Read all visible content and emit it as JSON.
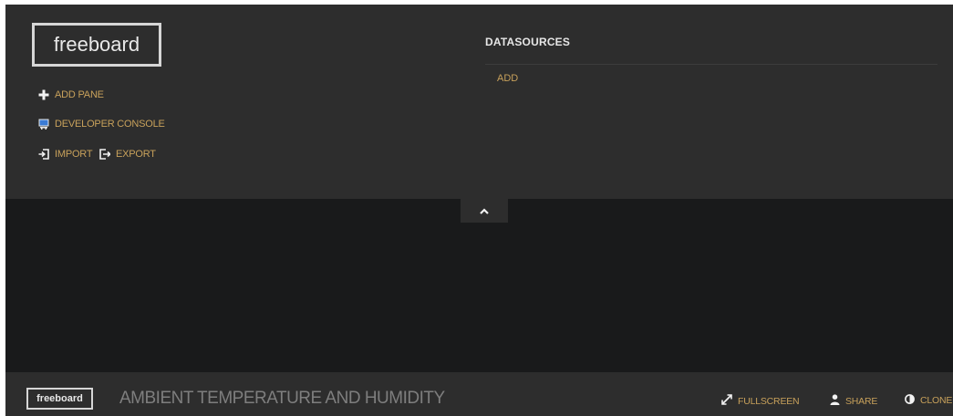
{
  "colors": {
    "panel_bg": "#2d2d2d",
    "board_bg": "#191a1b",
    "accent": "#c8a15b",
    "text_light": "#e6e6e6",
    "title_muted": "#7e7e7e"
  },
  "admin": {
    "logo": "freeboard",
    "menu": {
      "add_pane": {
        "label": "ADD PANE",
        "icon": "plus-icon"
      },
      "developer_console": {
        "label": "DEVELOPER CONSOLE",
        "icon": "console-icon"
      },
      "import": {
        "label": "IMPORT",
        "icon": "import-icon"
      },
      "export": {
        "label": "EXPORT",
        "icon": "export-icon"
      }
    },
    "datasources": {
      "heading": "DATASOURCES",
      "add_label": "ADD"
    },
    "toggle_icon": "chevron-up-icon"
  },
  "footer": {
    "logo": "freeboard",
    "dashboard_title": "AMBIENT TEMPERATURE AND HUMIDITY",
    "actions": {
      "fullscreen": {
        "label": "FULLSCREEN",
        "icon": "fullscreen-icon"
      },
      "share": {
        "label": "SHARE",
        "icon": "user-icon"
      },
      "clone": {
        "label": "CLONE",
        "icon": "clone-icon"
      }
    }
  }
}
